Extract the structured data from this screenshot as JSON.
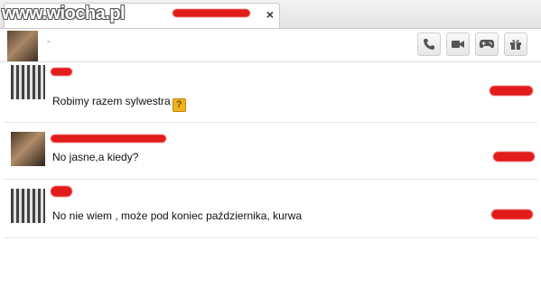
{
  "watermark": "www.wiocha.pl",
  "tab": {
    "title": "",
    "close_symbol": "×"
  },
  "header": {
    "status": "-",
    "buttons": [
      {
        "name": "call-button",
        "icon": "phone-icon"
      },
      {
        "name": "video-button",
        "icon": "video-camera-icon"
      },
      {
        "name": "games-button",
        "icon": "gamepad-icon"
      },
      {
        "name": "gift-button",
        "icon": "gift-icon"
      }
    ]
  },
  "messages": [
    {
      "text": "Robimy razem sylwestra",
      "emoticon": "?"
    },
    {
      "text": "No jasne,a kiedy?"
    },
    {
      "text": "No nie wiem , może pod koniec października, kurwa"
    }
  ],
  "colors": {
    "redaction": "#e21b1b",
    "accent": "#f1b21d"
  }
}
